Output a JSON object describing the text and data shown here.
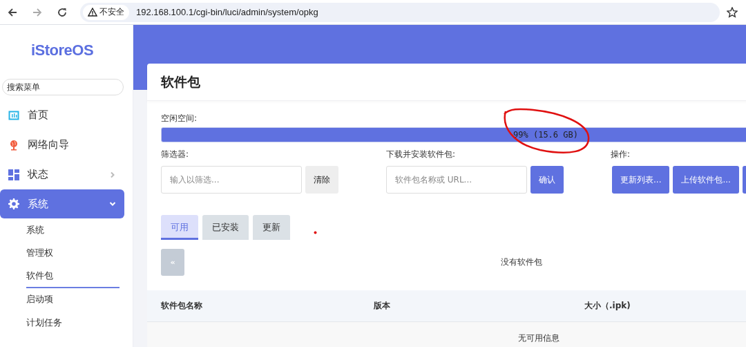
{
  "browser": {
    "security_badge": "不安全",
    "url": "192.168.100.1/cgi-bin/luci/admin/system/opkg"
  },
  "sidebar": {
    "logo": "iStoreOS",
    "search": {
      "placeholder": "搜索菜单"
    },
    "items": [
      {
        "label": "首页",
        "kind": "link",
        "selected": false
      },
      {
        "label": "网络向导",
        "kind": "link",
        "selected": false
      },
      {
        "label": "状态",
        "kind": "group",
        "expanded": false,
        "selected": false
      },
      {
        "label": "系统",
        "kind": "group",
        "expanded": true,
        "selected": true,
        "children": [
          {
            "label": "系统",
            "selected": false
          },
          {
            "label": "管理权",
            "selected": false
          },
          {
            "label": "软件包",
            "selected": true
          },
          {
            "label": "启动项",
            "selected": false
          },
          {
            "label": "计划任务",
            "selected": false
          }
        ]
      }
    ]
  },
  "page_title": "软件包",
  "free_space": {
    "label": "空闲空间:",
    "level": 0.99,
    "reading": "99% (15.6 GB)"
  },
  "filter": {
    "label": "筛选器:",
    "placeholder": "输入以筛选...",
    "button": "清除"
  },
  "install": {
    "label": "下载并安装软件包:",
    "placeholder": "软件包名称或 URL...",
    "button": "确认"
  },
  "actions": {
    "label": "操作:",
    "buttons": [
      "更新列表...",
      "上传软件包..."
    ]
  },
  "tabs": [
    {
      "label": "可用",
      "selected": true
    },
    {
      "label": "已安装",
      "selected": false
    },
    {
      "label": "更新",
      "selected": false
    }
  ],
  "pager": {
    "button": "«",
    "disabled": true
  },
  "message": "没有软件包",
  "table": {
    "columns": [
      "软件包名称",
      "版本",
      "大小（.ipk)"
    ],
    "empty_text": "无可用信息"
  }
}
